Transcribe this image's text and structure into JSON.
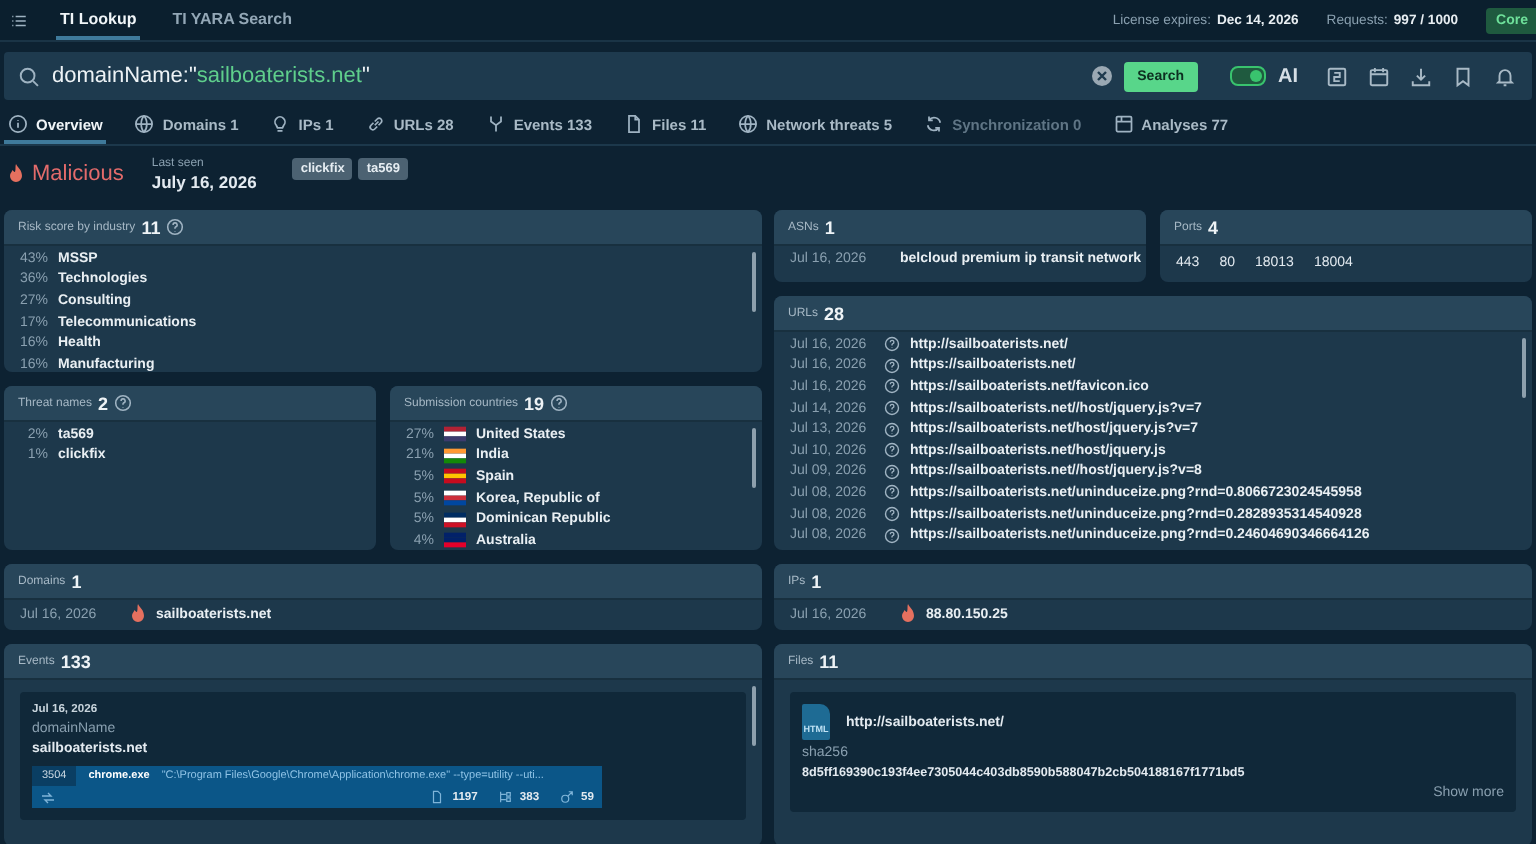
{
  "topbar": {
    "tabs": [
      {
        "label": "TI Lookup",
        "selected": true
      },
      {
        "label": "TI YARA Search",
        "selected": false
      }
    ],
    "license_label": "License expires:",
    "license_value": "Dec 14, 2026",
    "requests_label": "Requests:",
    "requests_value": "997 / 1000",
    "plan_badge": "Core"
  },
  "search": {
    "query": [
      {
        "kind": "key",
        "text": "domainName:\""
      },
      {
        "kind": "value",
        "text": "sailboaterists.net"
      },
      {
        "kind": "key",
        "text": "\""
      }
    ],
    "button": "Search",
    "ai_on": true,
    "ai_label": "AI"
  },
  "section_tabs": [
    {
      "label": "Overview",
      "selected": true,
      "disabled": false
    },
    {
      "label": "Domains 1",
      "selected": false,
      "disabled": false
    },
    {
      "label": "IPs 1",
      "selected": false,
      "disabled": false
    },
    {
      "label": "URLs 28",
      "selected": false,
      "disabled": false
    },
    {
      "label": "Events 133",
      "selected": false,
      "disabled": false
    },
    {
      "label": "Files 11",
      "selected": false,
      "disabled": false
    },
    {
      "label": "Network threats 5",
      "selected": false,
      "disabled": false
    },
    {
      "label": "Synchronization 0",
      "selected": false,
      "disabled": true
    },
    {
      "label": "Analyses 77",
      "selected": false,
      "disabled": false
    }
  ],
  "verdict": {
    "label": "Malicious",
    "last_seen_label": "Last seen",
    "last_seen": "July 16, 2026",
    "tags": [
      "clickfix",
      "ta569"
    ]
  },
  "risk_by_industry": {
    "title": "Risk score by industry",
    "count": "11",
    "rows": [
      {
        "share": "43%",
        "name": "MSSP"
      },
      {
        "share": "36%",
        "name": "Technologies"
      },
      {
        "share": "27%",
        "name": "Consulting"
      },
      {
        "share": "17%",
        "name": "Telecommunications"
      },
      {
        "share": "16%",
        "name": "Health"
      },
      {
        "share": "16%",
        "name": "Manufacturing"
      }
    ]
  },
  "threat_names": {
    "title": "Threat names",
    "count": "2",
    "rows": [
      {
        "share": "2%",
        "name": "ta569"
      },
      {
        "share": "1%",
        "name": "clickfix"
      }
    ]
  },
  "submission_countries": {
    "title": "Submission countries",
    "count": "19",
    "rows": [
      {
        "share": "27%",
        "name": "United States"
      },
      {
        "share": "21%",
        "name": "India"
      },
      {
        "share": "5%",
        "name": "Spain"
      },
      {
        "share": "5%",
        "name": "Korea, Republic of"
      },
      {
        "share": "5%",
        "name": "Dominican Republic"
      },
      {
        "share": "4%",
        "name": "Australia"
      }
    ]
  },
  "asns": {
    "title": "ASNs",
    "count": "1",
    "rows": [
      {
        "date": "Jul 16, 2026",
        "name": "belcloud premium ip transit network"
      }
    ]
  },
  "ports": {
    "title": "Ports",
    "count": "4",
    "values": [
      "443",
      "80",
      "18013",
      "18004"
    ]
  },
  "urls": {
    "title": "URLs",
    "count": "28",
    "rows": [
      {
        "date": "Jul 16, 2026",
        "url": "http://sailboaterists.net/"
      },
      {
        "date": "Jul 16, 2026",
        "url": "https://sailboaterists.net/"
      },
      {
        "date": "Jul 16, 2026",
        "url": "https://sailboaterists.net/favicon.ico"
      },
      {
        "date": "Jul 14, 2026",
        "url": "https://sailboaterists.net//host/jquery.js?v=7"
      },
      {
        "date": "Jul 13, 2026",
        "url": "https://sailboaterists.net/host/jquery.js?v=7"
      },
      {
        "date": "Jul 10, 2026",
        "url": "https://sailboaterists.net/host/jquery.js"
      },
      {
        "date": "Jul 09, 2026",
        "url": "https://sailboaterists.net//host/jquery.js?v=8"
      },
      {
        "date": "Jul 08, 2026",
        "url": "https://sailboaterists.net/uninduceize.png?rnd=0.8066723024545958"
      },
      {
        "date": "Jul 08, 2026",
        "url": "https://sailboaterists.net/uninduceize.png?rnd=0.2828935314540928"
      },
      {
        "date": "Jul 08, 2026",
        "url": "https://sailboaterists.net/uninduceize.png?rnd=0.24604690346664126"
      }
    ]
  },
  "domains": {
    "title": "Domains",
    "count": "1",
    "rows": [
      {
        "date": "Jul 16, 2026",
        "name": "sailboaterists.net"
      }
    ]
  },
  "ips": {
    "title": "IPs",
    "count": "1",
    "rows": [
      {
        "date": "Jul 16, 2026",
        "name": "88.80.150.25"
      }
    ]
  },
  "events": {
    "title": "Events",
    "count": "133",
    "card": {
      "date": "Jul 16, 2026",
      "field_label": "domainName",
      "field_value": "sailboaterists.net",
      "process": {
        "pid": "3504",
        "name": "chrome.exe",
        "command": "\"C:\\Program Files\\Google\\Chrome\\Application\\chrome.exe\" --type=utility --uti...",
        "files": "1197",
        "modules": "383",
        "connections": "59"
      }
    }
  },
  "files": {
    "title": "Files",
    "count": "11",
    "card": {
      "type": "HTML",
      "url": "http://sailboaterists.net/",
      "hash_label": "sha256",
      "hash": "8d5ff169390c193f4ee7305044c403db8590b588047b2cb504188167f1771bd5",
      "more": "Show more"
    }
  }
}
